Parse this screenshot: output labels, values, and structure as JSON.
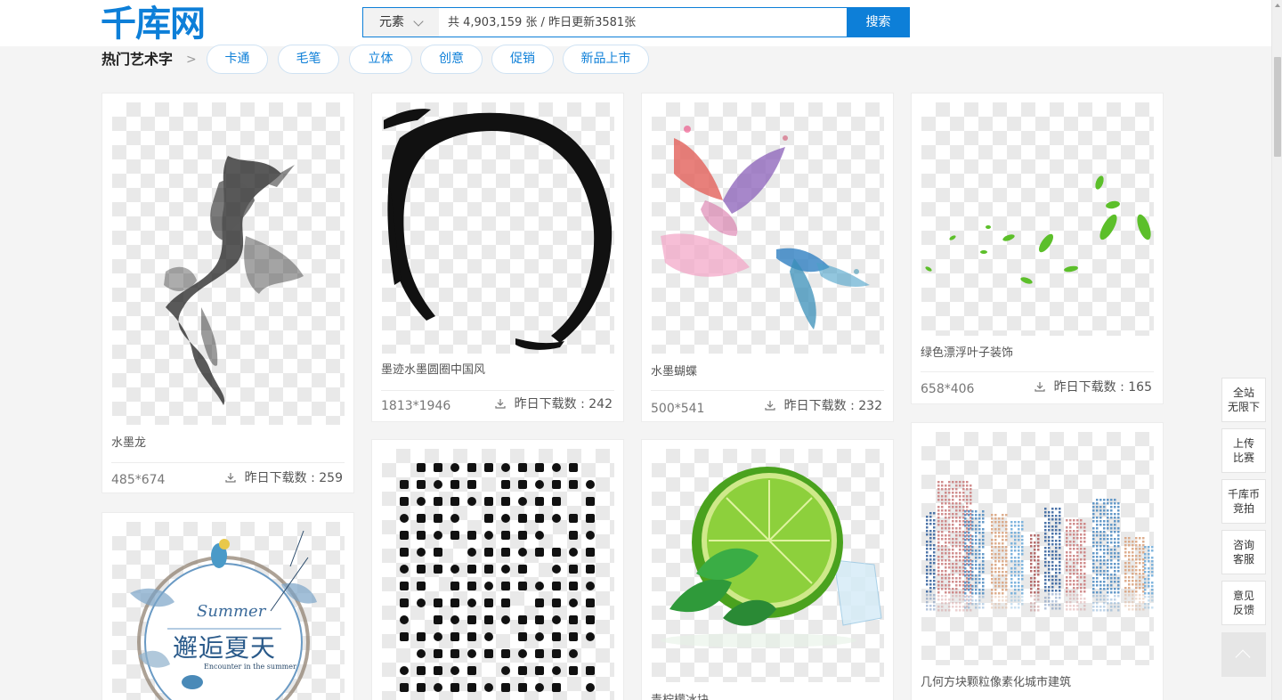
{
  "header": {
    "logo": "千库网",
    "search_type": "元素",
    "search_placeholder": "共 4,903,159 张 / 昨日更新3581张",
    "search_button": "搜索"
  },
  "tags": {
    "title": "热门艺术字",
    "arrow": ">",
    "items": [
      "卡通",
      "毛笔",
      "立体",
      "创意",
      "促销",
      "新品上市"
    ]
  },
  "cards": [
    {
      "title": "水墨龙",
      "size": "485*674",
      "downloads": "昨日下载数 : 259"
    },
    {
      "title": "墨迹水墨圆圈中国风",
      "size": "1813*1946",
      "downloads": "昨日下载数 : 242"
    },
    {
      "title": "水墨蝴蝶",
      "size": "500*541",
      "downloads": "昨日下载数 : 232"
    },
    {
      "title": "绿色漂浮叶子装饰",
      "size": "658*406",
      "downloads": "昨日下载数 : 165"
    },
    {
      "title": "",
      "thumb_text": {
        "script": "Summer",
        "main": "邂逅夏天",
        "sub": "Encounter in the summer"
      }
    },
    {
      "title": ""
    },
    {
      "title": "青柠檬冰块"
    },
    {
      "title": "几何方块颗粒像素化城市建筑"
    }
  ],
  "side_bar": [
    {
      "line1": "全站",
      "line2": "无限下"
    },
    {
      "line1": "上传",
      "line2": "比赛"
    },
    {
      "line1": "千库币",
      "line2": "竞拍"
    },
    {
      "line1": "咨询",
      "line2": "客服"
    },
    {
      "line1": "意见",
      "line2": "反馈"
    }
  ],
  "colors": {
    "brand": "#0d7fd8",
    "background": "#f4f4f4"
  },
  "icons": [
    "chevron-down-icon",
    "download-icon",
    "back-to-top-icon"
  ]
}
